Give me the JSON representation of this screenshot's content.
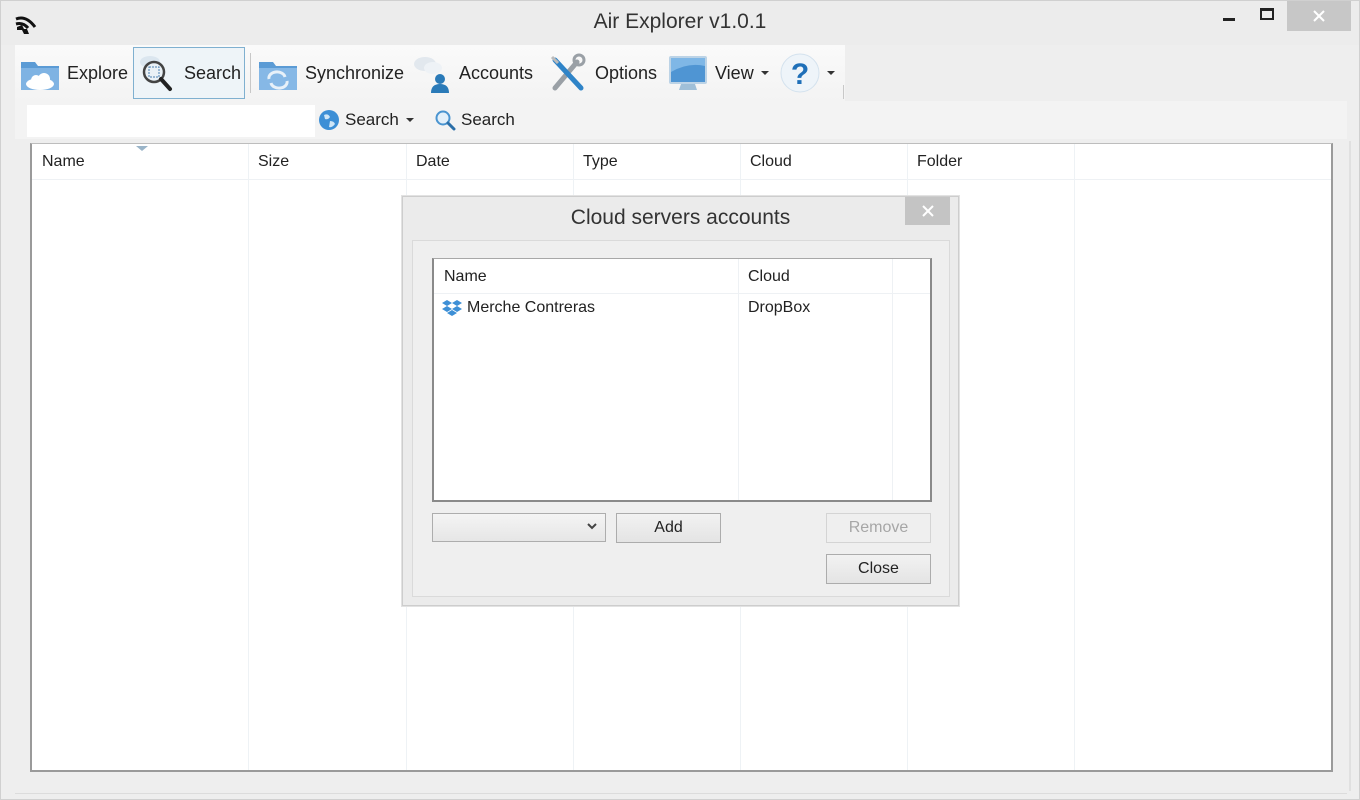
{
  "window": {
    "title": "Air Explorer v1.0.1",
    "controls": {
      "minimize": "minimize-icon",
      "maximize": "maximize-icon",
      "close": "close-icon"
    }
  },
  "toolbar": {
    "items": [
      {
        "label": "Explore",
        "icon": "cloud-folder-icon",
        "selected": false
      },
      {
        "label": "Search",
        "icon": "cloud-search-icon",
        "selected": true
      },
      {
        "label": "Synchronize",
        "icon": "sync-folder-icon",
        "selected": false
      },
      {
        "label": "Accounts",
        "icon": "cloud-user-icon",
        "selected": false
      },
      {
        "label": "Options",
        "icon": "tools-icon",
        "selected": false
      },
      {
        "label": "View",
        "icon": "monitor-icon",
        "selected": false,
        "dropdown": true
      },
      {
        "label": "",
        "icon": "help-icon",
        "selected": false,
        "dropdown": true
      }
    ]
  },
  "search_bar": {
    "query_value": "",
    "scope_label": "Search",
    "scope_icon": "globe-icon",
    "search_button_label": "Search",
    "search_button_icon": "magnifier-icon"
  },
  "results": {
    "columns": [
      "Name",
      "Size",
      "Date",
      "Type",
      "Cloud",
      "Folder"
    ],
    "sorted_column": "Name",
    "rows": []
  },
  "dialog": {
    "title": "Cloud servers accounts",
    "columns": [
      "Name",
      "Cloud"
    ],
    "accounts": [
      {
        "name": "Merche Contreras",
        "cloud": "DropBox",
        "icon": "dropbox-icon"
      }
    ],
    "cloud_select_value": "",
    "buttons": {
      "add": "Add",
      "remove": "Remove",
      "close": "Close"
    },
    "remove_enabled": false,
    "colors": {
      "dropbox": "#3d8fd6"
    }
  }
}
